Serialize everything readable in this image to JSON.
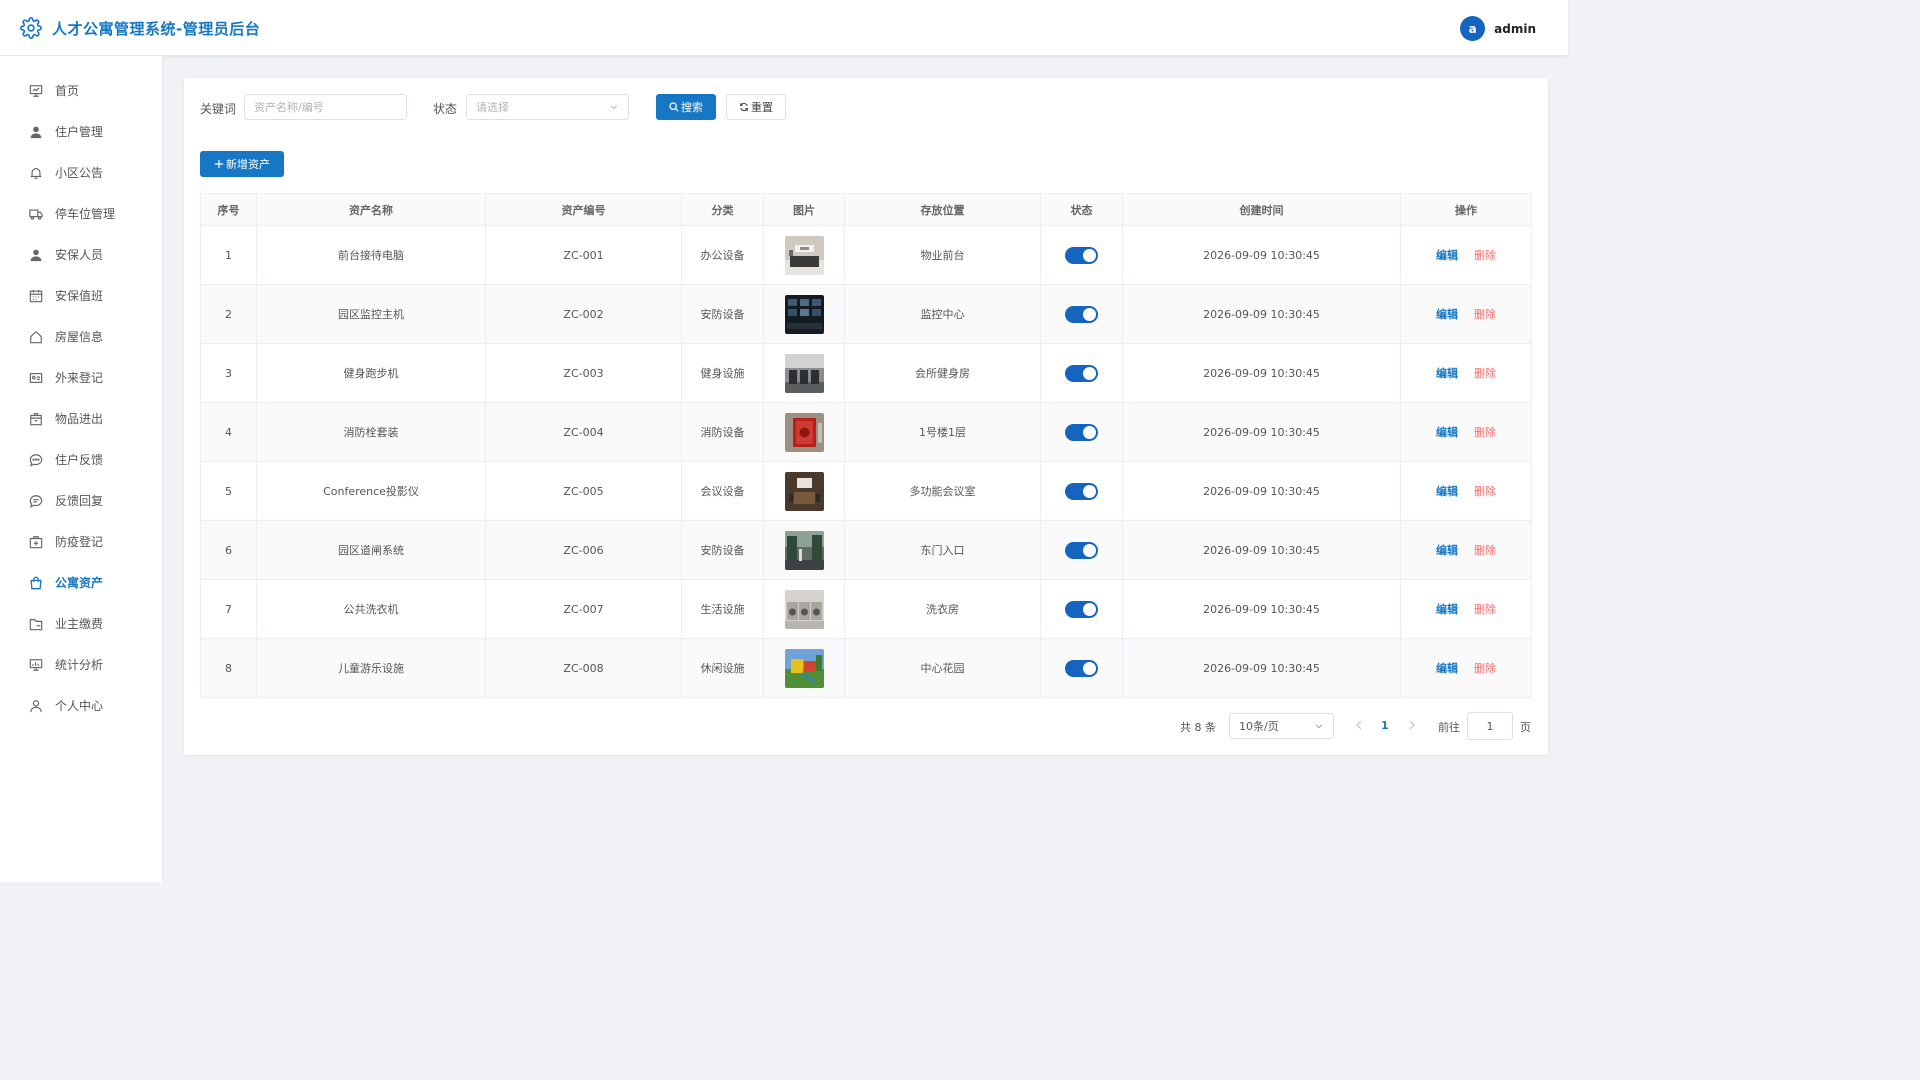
{
  "header": {
    "title": "人才公寓管理系统-管理员后台",
    "avatar_letter": "a",
    "username": "admin",
    "brand_color": "#1677c4"
  },
  "sidebar": {
    "items": [
      {
        "label": "首页",
        "icon": "presentation-icon"
      },
      {
        "label": "住户管理",
        "icon": "user-icon"
      },
      {
        "label": "小区公告",
        "icon": "bell-icon"
      },
      {
        "label": "停车位管理",
        "icon": "truck-icon"
      },
      {
        "label": "安保人员",
        "icon": "user-icon"
      },
      {
        "label": "安保值班",
        "icon": "calendar-icon"
      },
      {
        "label": "房屋信息",
        "icon": "house-icon"
      },
      {
        "label": "外来登记",
        "icon": "id-card-icon"
      },
      {
        "label": "物品进出",
        "icon": "box-icon"
      },
      {
        "label": "住户反馈",
        "icon": "chat-dots-icon"
      },
      {
        "label": "反馈回复",
        "icon": "chat-lines-icon"
      },
      {
        "label": "防疫登记",
        "icon": "first-aid-icon"
      },
      {
        "label": "公寓资产",
        "icon": "shopping-bag-icon",
        "active": true
      },
      {
        "label": "业主缴费",
        "icon": "folder-icon"
      },
      {
        "label": "统计分析",
        "icon": "chart-board-icon"
      },
      {
        "label": "个人中心",
        "icon": "user-outline-icon"
      }
    ]
  },
  "search": {
    "keyword_label": "关键词",
    "keyword_placeholder": "资产名称/编号",
    "status_label": "状态",
    "status_placeholder": "请选择",
    "search_button": "搜索",
    "reset_button": "重置",
    "add_button": "新增资产"
  },
  "table": {
    "headers": [
      "序号",
      "资产名称",
      "资产编号",
      "分类",
      "图片",
      "存放位置",
      "状态",
      "创建时间",
      "操作"
    ],
    "edit_label": "编辑",
    "delete_label": "删除",
    "rows": [
      {
        "index": "1",
        "name": "前台接待电脑",
        "code": "ZC-001",
        "category": "办公设备",
        "image": "reception-desk-photo",
        "location": "物业前台",
        "enabled": true,
        "created": "2026-09-09 10:30:45"
      },
      {
        "index": "2",
        "name": "园区监控主机",
        "code": "ZC-002",
        "category": "安防设备",
        "image": "monitoring-room-photo",
        "location": "监控中心",
        "enabled": true,
        "created": "2026-09-09 10:30:45"
      },
      {
        "index": "3",
        "name": "健身跑步机",
        "code": "ZC-003",
        "category": "健身设施",
        "image": "gym-treadmill-photo",
        "location": "会所健身房",
        "enabled": true,
        "created": "2026-09-09 10:30:45"
      },
      {
        "index": "4",
        "name": "消防栓套装",
        "code": "ZC-004",
        "category": "消防设备",
        "image": "fire-hydrant-photo",
        "location": "1号楼1层",
        "enabled": true,
        "created": "2026-09-09 10:30:45"
      },
      {
        "index": "5",
        "name": "Conference投影仪",
        "code": "ZC-005",
        "category": "会议设备",
        "image": "conference-room-photo",
        "location": "多功能会议室",
        "enabled": true,
        "created": "2026-09-09 10:30:45"
      },
      {
        "index": "6",
        "name": "园区道闸系统",
        "code": "ZC-006",
        "category": "安防设备",
        "image": "gate-barrier-photo",
        "location": "东门入口",
        "enabled": true,
        "created": "2026-09-09 10:30:45"
      },
      {
        "index": "7",
        "name": "公共洗衣机",
        "code": "ZC-007",
        "category": "生活设施",
        "image": "laundry-room-photo",
        "location": "洗衣房",
        "enabled": true,
        "created": "2026-09-09 10:30:45"
      },
      {
        "index": "8",
        "name": "儿童游乐设施",
        "code": "ZC-008",
        "category": "休闲设施",
        "image": "playground-photo",
        "location": "中心花园",
        "enabled": true,
        "created": "2026-09-09 10:30:45"
      }
    ]
  },
  "pagination": {
    "total": "共 8 条",
    "page_size": "10条/页",
    "current_page": "1",
    "goto_label": "前往",
    "goto_value": "1",
    "page_suffix": "页"
  }
}
